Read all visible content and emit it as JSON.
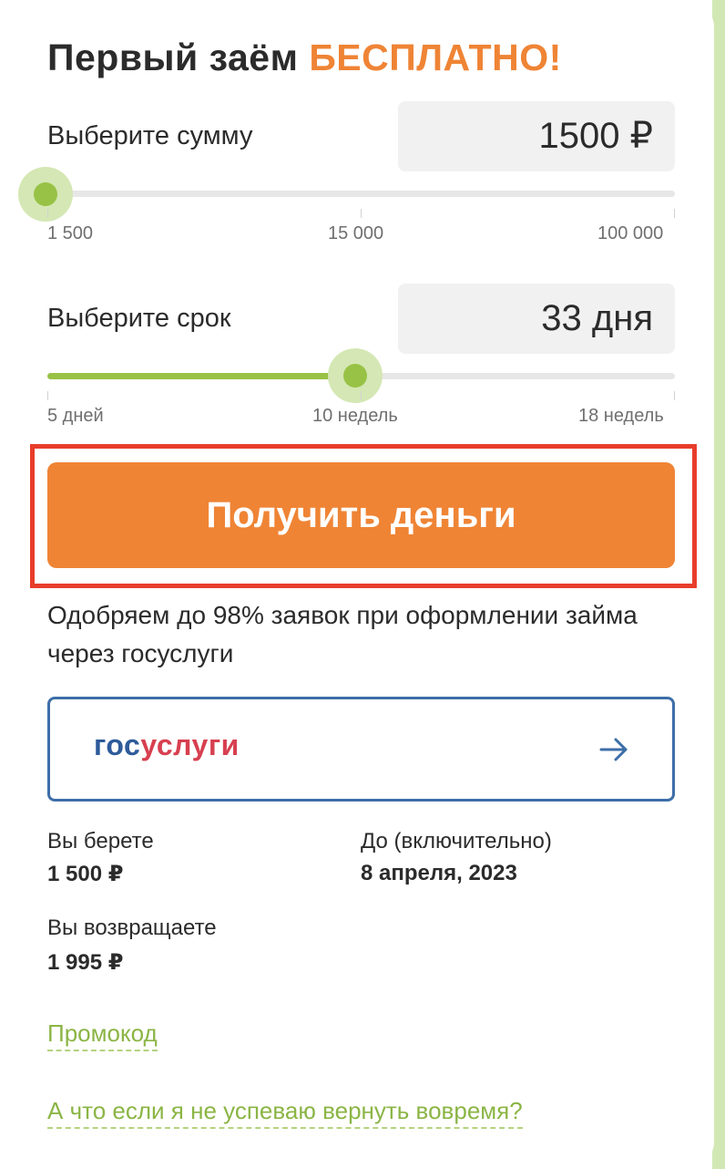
{
  "title": {
    "main": "Первый заём",
    "accent": "БЕСПЛАТНО!"
  },
  "amount": {
    "label": "Выберите сумму",
    "value": "1500 ₽",
    "slider_fraction": 0.0,
    "ticks": [
      "1 500",
      "15 000",
      "100 000"
    ]
  },
  "term": {
    "label": "Выберите срок",
    "value": "33 дня",
    "slider_fraction": 0.49,
    "ticks": [
      "5 дней",
      "10 недель",
      "18 недель"
    ]
  },
  "cta": {
    "label": "Получить деньги"
  },
  "approval_text": "Одобряем до 98% заявок при оформлении займа через госуслуги",
  "gosuslugi": {
    "logo_part1": "гос",
    "logo_part2": "услуги",
    "icon": "arrow-right-icon"
  },
  "summary": {
    "take_label": "Вы берете",
    "take_value": "1 500 ₽",
    "until_label": "До (включительно)",
    "until_value": "8 апреля, 2023",
    "return_label": "Вы возвращаете",
    "return_value": "1 995 ₽"
  },
  "links": {
    "promo": "Промокод",
    "late": "А что если я не успеваю вернуть вовремя?"
  },
  "colors": {
    "accent": "#ef8435",
    "slider": "#98c245",
    "highlight": "#e83d2b",
    "gos_blue": "#2e5b9a",
    "gos_red": "#d74050"
  }
}
